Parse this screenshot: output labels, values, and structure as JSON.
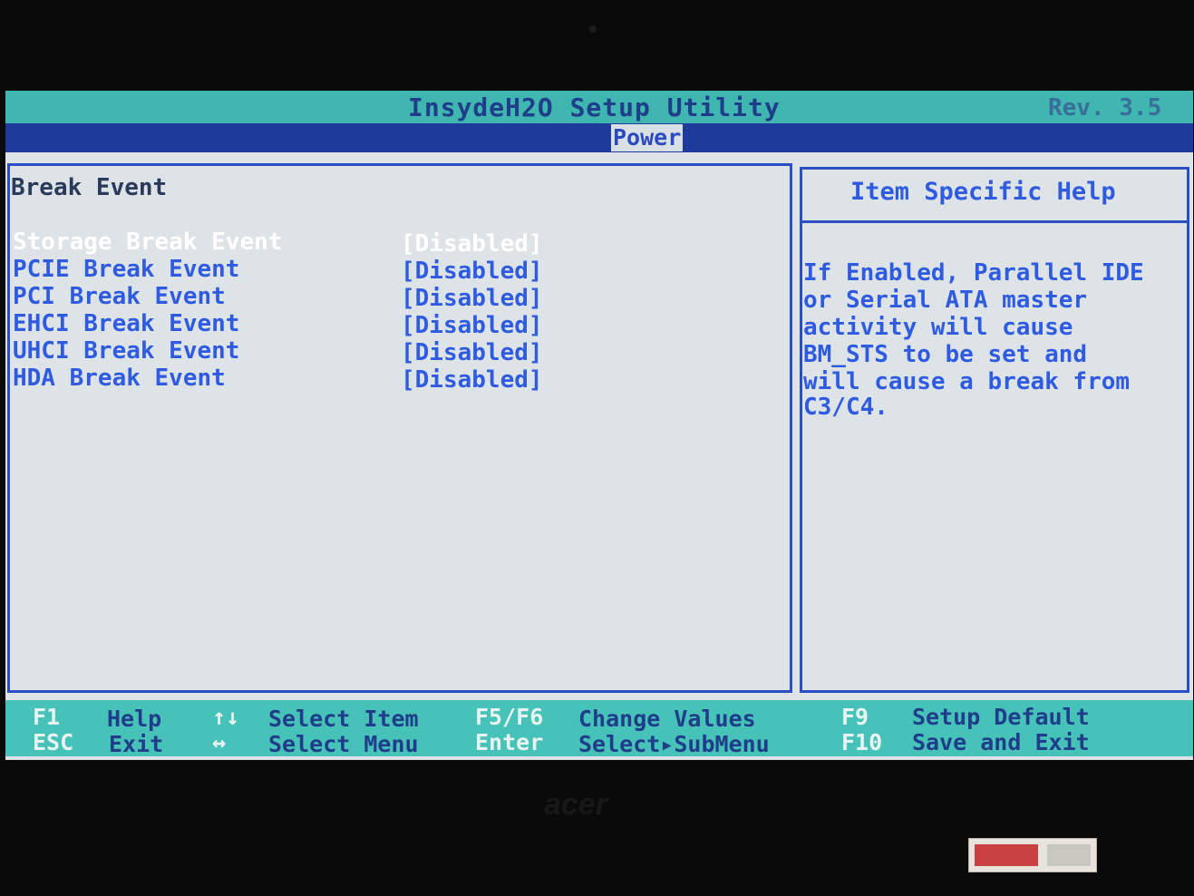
{
  "header": {
    "title": "InsydeH2O Setup Utility",
    "revision": "Rev. 3.5",
    "active_tab": "Power"
  },
  "main": {
    "section_title": "Break Event",
    "items": [
      {
        "label": "Storage Break Event",
        "value": "[Disabled]",
        "selected": true
      },
      {
        "label": "PCIE Break Event",
        "value": "[Disabled]",
        "selected": false
      },
      {
        "label": "PCI Break Event",
        "value": "[Disabled]",
        "selected": false
      },
      {
        "label": "EHCI Break Event",
        "value": "[Disabled]",
        "selected": false
      },
      {
        "label": "UHCI Break Event",
        "value": "[Disabled]",
        "selected": false
      },
      {
        "label": "HDA Break Event",
        "value": "[Disabled]",
        "selected": false
      }
    ]
  },
  "help": {
    "title": "Item Specific Help",
    "lines": [
      "If Enabled, Parallel IDE",
      "or Serial ATA master",
      "activity will cause",
      "BM_STS to be set and",
      "will cause a break from",
      "C3/C4."
    ]
  },
  "footer": {
    "keys": [
      {
        "key": "F1",
        "desc": "Help"
      },
      {
        "key": "ESC",
        "desc": "Exit"
      },
      {
        "key": "↑↓",
        "desc": "Select Item"
      },
      {
        "key": "↔",
        "desc": "Select Menu"
      },
      {
        "key": "F5/F6",
        "desc": "Change Values"
      },
      {
        "key": "Enter",
        "desc": "Select▸SubMenu"
      },
      {
        "key": "F9",
        "desc": "Setup Default"
      },
      {
        "key": "F10",
        "desc": "Save and Exit"
      }
    ]
  },
  "bezel": {
    "brand": "acer"
  },
  "colors": {
    "title_bar": "#3fb6b0",
    "menu_bar": "#1e3a9a",
    "panel_bg": "#dde3e6",
    "item_text": "#2f5be0",
    "selected_text": "#ffffff"
  }
}
